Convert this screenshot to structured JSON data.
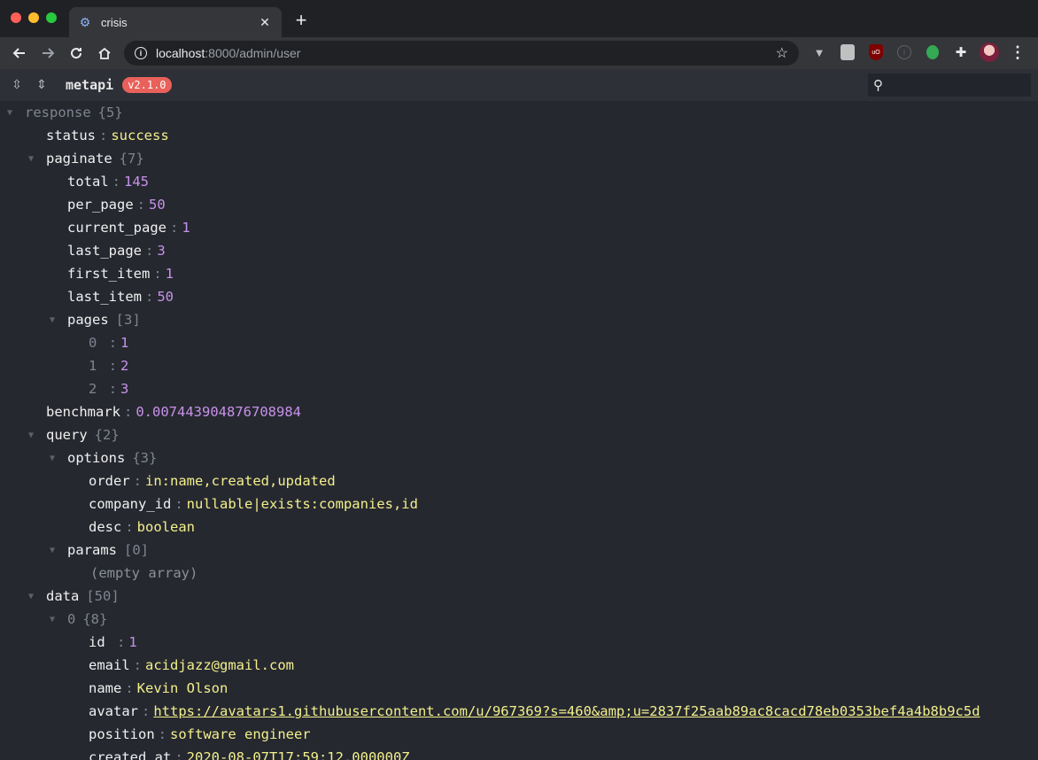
{
  "browser": {
    "tab_title": "crisis",
    "url_host": "localhost",
    "url_rest": ":8000/admin/user"
  },
  "viewer": {
    "app_name": "metapi",
    "version": "v2.1.0",
    "search_placeholder": ""
  },
  "tree": {
    "root_key": "response",
    "root_count": "{5}",
    "status_key": "status",
    "status_val": "success",
    "paginate_key": "paginate",
    "paginate_count": "{7}",
    "total_key": "total",
    "total_val": "145",
    "per_page_key": "per_page",
    "per_page_val": "50",
    "current_page_key": "current_page",
    "current_page_val": "1",
    "last_page_key": "last_page",
    "last_page_val": "3",
    "first_item_key": "first_item",
    "first_item_val": "1",
    "last_item_key": "last_item",
    "last_item_val": "50",
    "pages_key": "pages",
    "pages_count": "[3]",
    "pages": [
      {
        "idx": "0",
        "val": "1"
      },
      {
        "idx": "1",
        "val": "2"
      },
      {
        "idx": "2",
        "val": "3"
      }
    ],
    "benchmark_key": "benchmark",
    "benchmark_val": "0.007443904876708984",
    "query_key": "query",
    "query_count": "{2}",
    "options_key": "options",
    "options_count": "{3}",
    "order_key": "order",
    "order_val": "in:name,created,updated",
    "company_id_key": "company_id",
    "company_id_val": "nullable|exists:companies,id",
    "desc_key": "desc",
    "desc_val": "boolean",
    "params_key": "params",
    "params_count": "[0]",
    "empty_array": "(empty array)",
    "data_key": "data",
    "data_count": "[50]",
    "item0_key": "0",
    "item0_count": "{8}",
    "id_key": "id",
    "id_val": "1",
    "email_key": "email",
    "email_val": "acidjazz@gmail.com",
    "name_key": "name",
    "name_val": "Kevin Olson",
    "avatar_key": "avatar",
    "avatar_val": "https://avatars1.githubusercontent.com/u/967369?s=460&amp;u=2837f25aab89ac8cacd78eb0353bef4a4b8b9c5d",
    "position_key": "position",
    "position_val": "software engineer",
    "created_at_key": "created_at",
    "created_at_val": "2020-08-07T17:59:12.000000Z"
  }
}
